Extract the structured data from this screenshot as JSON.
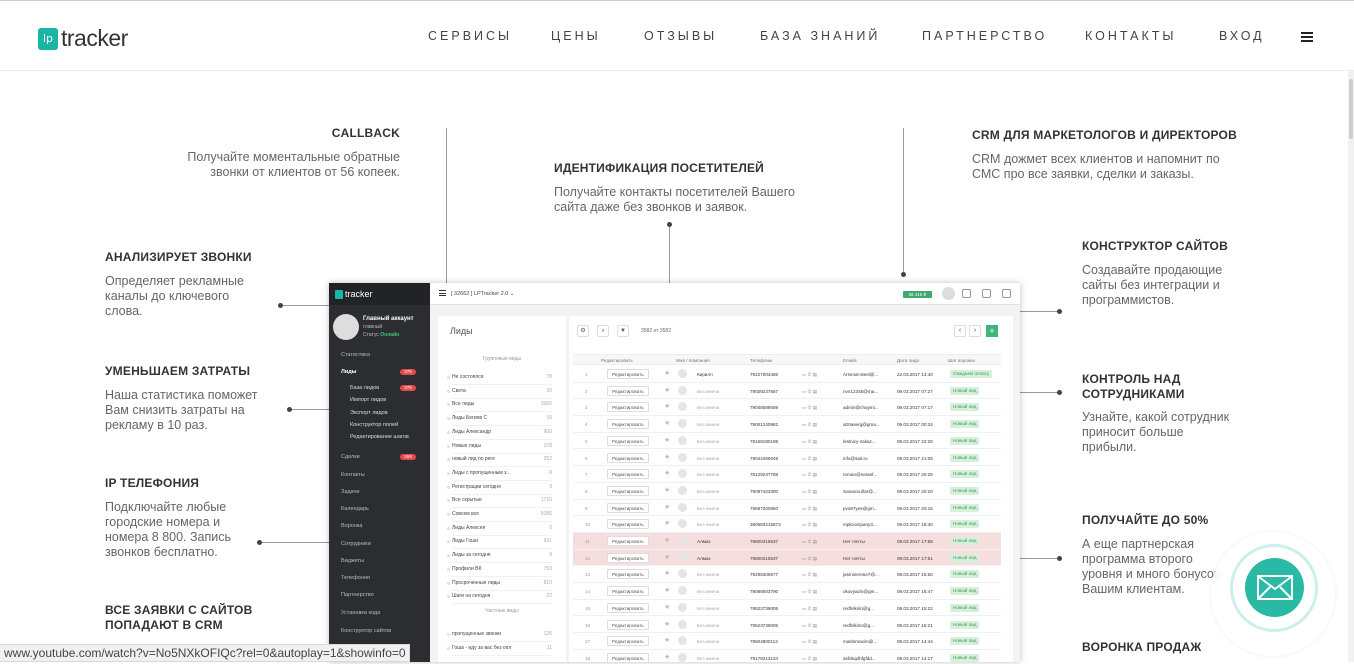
{
  "header": {
    "logo_badge": "lp",
    "logo_text": "tracker",
    "nav": [
      "СЕРВИСЫ",
      "ЦЕНЫ",
      "ОТЗЫВЫ",
      "БАЗА ЗНАНИЙ",
      "ПАРТНЕРСТВО",
      "КОНТАКТЫ",
      "ВХОД"
    ]
  },
  "features": {
    "callback": {
      "title": "CALLBACK",
      "text": "Получайте моментальные обратные звонки от клиентов от 56 копеек."
    },
    "identify": {
      "title": "ИДЕНТИФИКАЦИЯ ПОСЕТИТЕЛЕЙ",
      "text": "Получайте контакты посетителей Вашего сайта даже без звонков и заявок."
    },
    "crm": {
      "title": "CRM ДЛЯ МАРКЕТОЛОГОВ И ДИРЕКТОРОВ",
      "text": "CRM дожмет всех клиентов и напомнит по СМС про все заявки, сделки и заказы."
    },
    "analyze": {
      "title": "АНАЛИЗИРУЕТ  ЗВОНКИ",
      "text": "Определяет рекламные каналы до ключевого слова."
    },
    "builder": {
      "title": "КОНСТРУКТОР САЙТОВ",
      "text": "Создавайте продающие сайты без интеграции и программистов."
    },
    "reduce": {
      "title": "УМЕНЬШАЕМ ЗАТРАТЫ",
      "text": "Наша статистика поможет Вам снизить затраты на рекламу в 10 раз."
    },
    "control": {
      "title": "КОНТРОЛЬ НАД СОТРУДНИКАМИ",
      "text": "Узнайте, какой сотрудник приносит больше прибыли."
    },
    "ip": {
      "title": "IP ТЕЛЕФОНИЯ",
      "text": "Подключайте любые городские номера и номера 8 800.  Запись звонков бесплатно."
    },
    "partner": {
      "title": "ПОЛУЧАЙТЕ ДО 50%",
      "text": "А еще партнерская программа второго уровня и много бонусов Вашим клиентам."
    },
    "leads": {
      "title": "ВСЕ ЗАЯВКИ  С САЙТОВ ПОПАДАЮТ В CRM",
      "text": ""
    },
    "funnel": {
      "title": "ВОРОНКА ПРОДАЖ",
      "text": ""
    }
  },
  "dashboard": {
    "logo": "tracker",
    "topbar_title": "[ 32662 ] LPTracker 2.0 ⌄",
    "balance": "36 416 ₽",
    "account_name": "Главный аккаунт",
    "account_role": "главный",
    "account_status_label": "Статус",
    "account_status": "Онлайн",
    "sidebar": [
      {
        "label": "Статистика"
      },
      {
        "label": "Лиды",
        "badge": "378"
      },
      {
        "label": "База лидов",
        "badge": "378",
        "sub": true
      },
      {
        "label": "Импорт лидов",
        "sub": true
      },
      {
        "label": "Экспорт лидов",
        "sub": true
      },
      {
        "label": "Конструктор полей",
        "sub": true
      },
      {
        "label": "Редактирование шагов",
        "sub": true
      },
      {
        "label": "Сделки",
        "badge": "269"
      },
      {
        "label": "Контакты"
      },
      {
        "label": "Задачи"
      },
      {
        "label": "Календарь"
      },
      {
        "label": "Воронка"
      },
      {
        "label": "Сотрудники"
      },
      {
        "label": "Виджеты"
      },
      {
        "label": "Телефония"
      },
      {
        "label": "Партнерство"
      },
      {
        "label": "Установка кода"
      },
      {
        "label": "Конструктор сайтов"
      }
    ],
    "groups_title": "Лиды",
    "groups_section1": "Групповые виды",
    "groups": [
      {
        "name": "Не состоялся",
        "count": "78"
      },
      {
        "name": "Света",
        "count": "10"
      },
      {
        "name": "Все лиды",
        "count": "3365"
      },
      {
        "name": "Лиды Бегиев С",
        "count": "16"
      },
      {
        "name": "Лиды Александр",
        "count": "900"
      },
      {
        "name": "Новые лиды",
        "count": "378"
      },
      {
        "name": "новый лид по реге",
        "count": "252"
      },
      {
        "name": "Лиды с пропущенным з...",
        "count": "8"
      },
      {
        "name": "Регистрации сегодня",
        "count": "3"
      },
      {
        "name": "Все скрытые",
        "count": "1716"
      },
      {
        "name": "Совсем все",
        "count": "5086"
      },
      {
        "name": "Лиды Алексея",
        "count": "0"
      },
      {
        "name": "Лиды Гоши",
        "count": "931"
      },
      {
        "name": "Лиды за сегодня",
        "count": "9"
      },
      {
        "name": "Профили ВК",
        "count": "753"
      },
      {
        "name": "Просроченные лиды",
        "count": "810"
      },
      {
        "name": "Шаги на сегодня",
        "count": "22"
      }
    ],
    "groups_section2": "Частные виды",
    "groups2": [
      {
        "name": "пропущенные звонки",
        "count": "126"
      },
      {
        "name": "Гоша - иду за вас без опл",
        "count": "11"
      }
    ],
    "pagination": "3582 от 3582",
    "columns": [
      "Редактировать",
      "Имя / Компания",
      "Телефоны",
      "Emails",
      "Дата лида",
      "Шаг воронки"
    ],
    "rows": [
      {
        "n": "1",
        "name": "Кирилл",
        "phone": "79227004466",
        "email": "Arsenal-steel@...",
        "date": "22.03.2017 14:40",
        "step": "Ожидаем оплату",
        "hl": false
      },
      {
        "n": "2",
        "name": "Без имени",
        "phone": "79029237657",
        "email": "nvn12345@ma...",
        "date": "09.03.2017 07:27",
        "step": "Новый лид",
        "hl": false
      },
      {
        "n": "3",
        "name": "Без имени",
        "phone": "79048589089",
        "email": "admin@chaymi...",
        "date": "09.03.2017 07:17",
        "step": "Новый лид",
        "hl": false
      },
      {
        "n": "4",
        "name": "Без имени",
        "phone": "79001240982",
        "email": "a00aserg@gma...",
        "date": "09.03.2017 00:34",
        "step": "Новый лид",
        "hl": false
      },
      {
        "n": "5",
        "name": "Без имени",
        "phone": "79168180199",
        "email": "lestnicy-zakaz...",
        "date": "08.03.2017 22:28",
        "step": "Новый лид",
        "hl": false
      },
      {
        "n": "6",
        "name": "Без имени",
        "phone": "79044466049",
        "email": "info@sait.ru",
        "date": "08.03.2017 21:06",
        "step": "Новый лид",
        "hl": false
      },
      {
        "n": "7",
        "name": "Без имени",
        "phone": "78129237788",
        "email": "roman@netanf...",
        "date": "08.03.2017 20:26",
        "step": "Новый лид",
        "hl": false
      },
      {
        "n": "8",
        "name": "Без имени",
        "phone": "79097423300",
        "email": "Sanarov.illar@...",
        "date": "08.03.2017 20:20",
        "step": "Новый лид",
        "hl": false
      },
      {
        "n": "9",
        "name": "Без имени",
        "phone": "79687200950",
        "email": "pvo87yes@gm...",
        "date": "08.03.2017 20:15",
        "step": "Новый лид",
        "hl": false
      },
      {
        "n": "10",
        "name": "Без имени",
        "phone": "380683215873",
        "email": "mpkcompany3...",
        "date": "08.03.2017 18:40",
        "step": "Новый лид",
        "hl": false
      },
      {
        "n": "11",
        "name": "Алмаз",
        "phone": "79600415537",
        "email": "Нет почты",
        "date": "08.03.2017 17:58",
        "step": "Новый лид",
        "hl": true
      },
      {
        "n": "12",
        "name": "Алмаз",
        "phone": "79600415537",
        "email": "Нет почты",
        "date": "08.03.2017 17:51",
        "step": "Новый лид",
        "hl": true
      },
      {
        "n": "13",
        "name": "Без имени",
        "phone": "79298306677",
        "email": "jasminerose7@...",
        "date": "08.03.2017 16:50",
        "step": "Новый лид",
        "hl": false
      },
      {
        "n": "14",
        "name": "Без имени",
        "phone": "79089003790",
        "email": "okovyazin@gm...",
        "date": "08.03.2017 16:47",
        "step": "Новый лид",
        "hl": false
      },
      {
        "n": "15",
        "name": "Без имени",
        "phone": "79523739005",
        "email": "redfolkirin@g...",
        "date": "08.03.2017 15:22",
        "step": "Новый лид",
        "hl": false
      },
      {
        "n": "16",
        "name": "Без имени",
        "phone": "79523739005",
        "email": "redfolkirin@g...",
        "date": "08.03.2017 15:21",
        "step": "Новый лид",
        "hl": false
      },
      {
        "n": "17",
        "name": "Без имени",
        "phone": "79504800113",
        "email": "maslnmaxim@...",
        "date": "08.03.2017 14:44",
        "step": "Новый лид",
        "hl": false
      },
      {
        "n": "18",
        "name": "Без имени",
        "phone": "79178213134",
        "email": "asfdsqdhfgfdd...",
        "date": "08.03.2017 14:17",
        "step": "Новый лид",
        "hl": false
      }
    ]
  },
  "statusbar": "www.youtube.com/watch?v=No5NXkOFIQc?rel=0&autoplay=1&showinfo=0",
  "colors": {
    "accent": "#19b5a5",
    "mail_button": "#2ab9a4",
    "badge_green": "#3fa86d"
  },
  "icons": {
    "menu": "hamburger-icon",
    "mail": "envelope-icon"
  }
}
